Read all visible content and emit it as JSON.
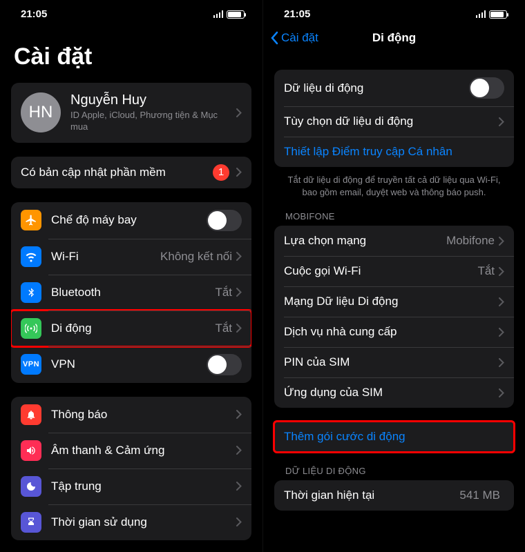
{
  "status": {
    "time": "21:05"
  },
  "left": {
    "title": "Cài đặt",
    "profile": {
      "initials": "HN",
      "name": "Nguyễn Huy",
      "sub": "ID Apple, iCloud, Phương tiện & Mục mua"
    },
    "update": {
      "label": "Có bản cập nhật phần mềm",
      "badge": "1"
    },
    "airplane": "Chế độ máy bay",
    "wifi": {
      "label": "Wi-Fi",
      "value": "Không kết nối"
    },
    "bluetooth": {
      "label": "Bluetooth",
      "value": "Tắt"
    },
    "cellular": {
      "label": "Di động",
      "value": "Tắt"
    },
    "vpn": "VPN",
    "notif": "Thông báo",
    "sound": "Âm thanh & Cảm ứng",
    "focus": "Tập trung",
    "screentime": "Thời gian sử dụng"
  },
  "right": {
    "back": "Cài đặt",
    "title": "Di động",
    "data_toggle": "Dữ liệu di động",
    "data_options": "Tùy chọn dữ liệu di động",
    "hotspot": "Thiết lập Điểm truy cập Cá nhân",
    "note": "Tắt dữ liệu di động để truyền tất cả dữ liệu qua Wi-Fi, bao gồm email, duyệt web và thông báo push.",
    "carrier_header": "MOBIFONE",
    "network_sel": {
      "label": "Lựa chọn mạng",
      "value": "Mobifone"
    },
    "wifi_call": {
      "label": "Cuộc gọi Wi-Fi",
      "value": "Tắt"
    },
    "data_network": "Mạng Dữ liệu Di động",
    "carrier_svc": "Dịch vụ nhà cung cấp",
    "sim_pin": "PIN của SIM",
    "sim_apps": "Ứng dụng của SIM",
    "add_plan": "Thêm gói cước di động",
    "usage_header": "DỮ LIỆU DI ĐỘNG",
    "current_period": {
      "label": "Thời gian hiện tại",
      "value": "541 MB"
    }
  }
}
